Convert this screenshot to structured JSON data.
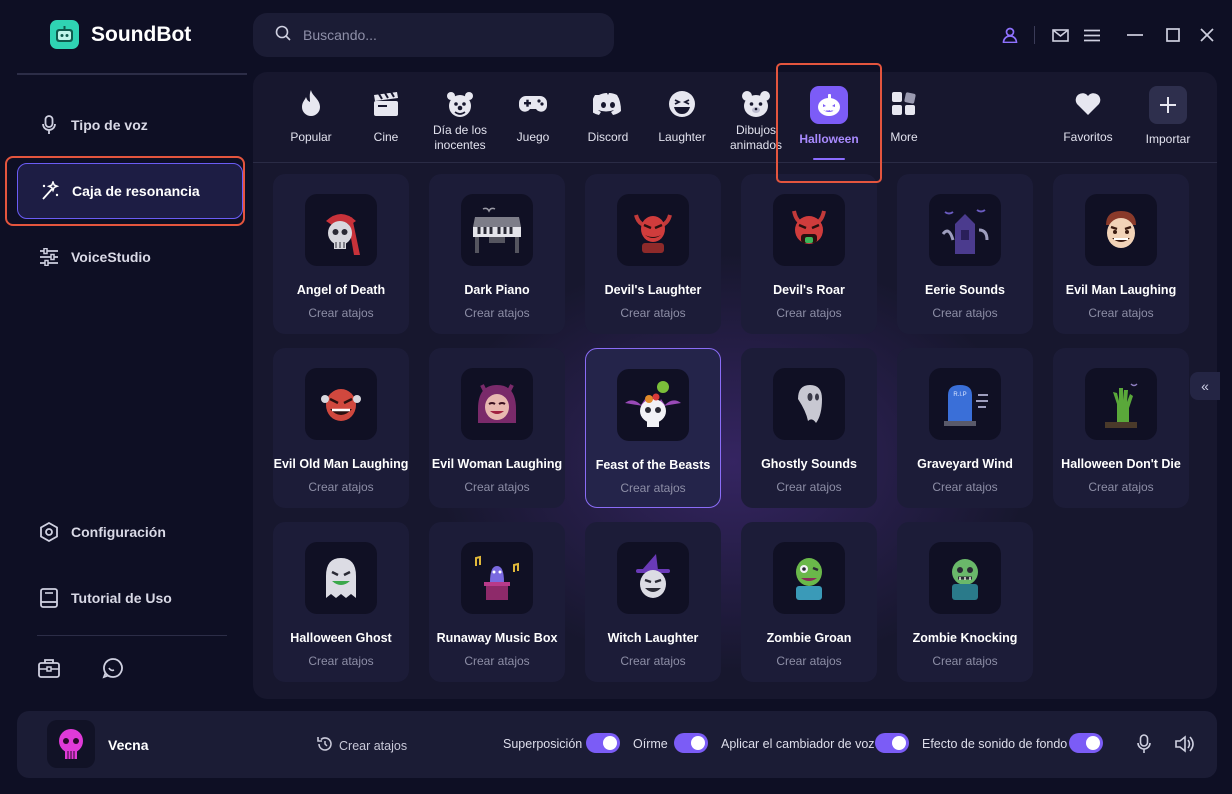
{
  "app": {
    "name": "SoundBot"
  },
  "search": {
    "placeholder": "Buscando..."
  },
  "sidebar": {
    "items": [
      {
        "label": "Tipo de voz",
        "icon": "microphone-icon"
      },
      {
        "label": "Caja de resonancia",
        "icon": "magic-wand-icon",
        "active": true
      },
      {
        "label": "VoiceStudio",
        "icon": "sliders-icon"
      }
    ],
    "bottom_items": [
      {
        "label": "Configuración",
        "icon": "gear-icon"
      },
      {
        "label": "Tutorial de Uso",
        "icon": "book-icon"
      }
    ],
    "tools": [
      "toolbox-icon",
      "chat-icon"
    ]
  },
  "categories": [
    {
      "label": "Popular",
      "icon": "flame-icon"
    },
    {
      "label": "Cine",
      "icon": "clapperboard-icon"
    },
    {
      "label": "Día de los inocentes",
      "icon": "clown-icon"
    },
    {
      "label": "Juego",
      "icon": "gamepad-icon"
    },
    {
      "label": "Discord",
      "icon": "discord-icon"
    },
    {
      "label": "Laughter",
      "icon": "laughing-face-icon"
    },
    {
      "label": "Dibujos animados",
      "icon": "bear-icon"
    },
    {
      "label": "Halloween",
      "icon": "pumpkin-icon",
      "active": true
    },
    {
      "label": "More",
      "icon": "grid-icon"
    },
    {
      "label": "Favoritos",
      "icon": "heart-icon"
    },
    {
      "label": "Importar",
      "icon": "plus-icon"
    }
  ],
  "sounds": [
    {
      "name": "Angel of Death",
      "sub": "Crear atajos",
      "icon": "reaper-icon"
    },
    {
      "name": "Dark Piano",
      "sub": "Crear atajos",
      "icon": "piano-icon"
    },
    {
      "name": "Devil's Laughter",
      "sub": "Crear atajos",
      "icon": "devil-icon"
    },
    {
      "name": "Devil's Roar",
      "sub": "Crear atajos",
      "icon": "devil-roar-icon"
    },
    {
      "name": "Eerie Sounds",
      "sub": "Crear atajos",
      "icon": "haunted-house-icon"
    },
    {
      "name": "Evil Man Laughing",
      "sub": "Crear atajos",
      "icon": "evil-man-icon"
    },
    {
      "name": "Evil Old Man Laughing",
      "sub": "Crear atajos",
      "icon": "old-man-icon"
    },
    {
      "name": "Evil Woman Laughing",
      "sub": "Crear atajos",
      "icon": "evil-woman-icon"
    },
    {
      "name": "Feast of the Beasts",
      "sub": "Crear atajos",
      "icon": "skull-bat-icon",
      "selected": true
    },
    {
      "name": "Ghostly Sounds",
      "sub": "Crear atajos",
      "icon": "ghost-icon"
    },
    {
      "name": "Graveyard Wind",
      "sub": "Crear atajos",
      "icon": "tombstone-icon"
    },
    {
      "name": "Halloween Don't Die",
      "sub": "Crear atajos",
      "icon": "zombie-hand-icon"
    },
    {
      "name": "Halloween Ghost",
      "sub": "Crear atajos",
      "icon": "halloween-ghost-icon"
    },
    {
      "name": "Runaway Music Box",
      "sub": "Crear atajos",
      "icon": "music-box-icon"
    },
    {
      "name": "Witch Laughter",
      "sub": "Crear atajos",
      "icon": "witch-icon"
    },
    {
      "name": "Zombie Groan",
      "sub": "Crear atajos",
      "icon": "zombie-icon"
    },
    {
      "name": "Zombie Knocking",
      "sub": "Crear atajos",
      "icon": "zombie-knocking-icon"
    }
  ],
  "bottom_bar": {
    "voice_name": "Vecna",
    "voice_icon": "skull-icon",
    "shortcut_label": "Crear atajos",
    "toggles": [
      {
        "label": "Superposición",
        "on": true
      },
      {
        "label": "Oírme",
        "on": true
      },
      {
        "label": "Aplicar el cambiador de voz",
        "on": true
      },
      {
        "label": "Efecto de sonido de fondo",
        "on": true
      }
    ]
  },
  "colors": {
    "accent": "#7b5cf6",
    "background": "#0e0f24",
    "highlight": "#e4553e",
    "logo": "#2fd3b3"
  }
}
